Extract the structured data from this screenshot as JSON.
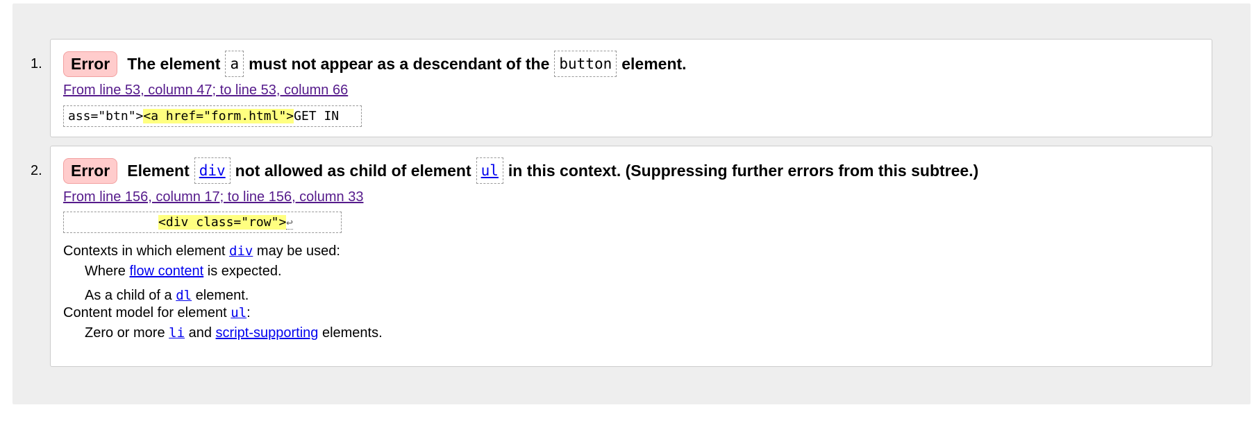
{
  "results": [
    {
      "number": "1.",
      "badge": "Error",
      "msg_parts": [
        "The element",
        "a",
        "must not appear as a descendant of the",
        "button",
        "element."
      ],
      "location": "From line 53, column 47; to line 53, column 66",
      "extract_before": "ass=\"btn\">",
      "extract_highlight": "<a href=\"form.html\">",
      "extract_after": "GET IN"
    },
    {
      "number": "2.",
      "badge": "Error",
      "msg_parts": [
        "Element",
        "div",
        "not allowed as child of element",
        "ul",
        "in this context. (Suppressing further errors from this subtree.)"
      ],
      "location": "From line 156, column 17; to line 156, column 33",
      "extract_before": "            ",
      "extract_highlight": "<div class=\"row\">",
      "extract_after": "↩",
      "details": {
        "contexts_prefix": "Contexts in which element",
        "contexts_code": "div",
        "contexts_suffix": "may be used:",
        "where_prefix": "Where",
        "where_link": "flow content",
        "where_suffix": "is expected.",
        "child_prefix": "As a child of a",
        "child_code": "dl",
        "child_suffix": "element.",
        "model_prefix": "Content model for element",
        "model_code": "ul",
        "model_suffix": ":",
        "zero_prefix": "Zero or more",
        "zero_code": "li",
        "zero_mid": "and",
        "zero_link": "script-supporting",
        "zero_suffix": "elements."
      }
    }
  ]
}
